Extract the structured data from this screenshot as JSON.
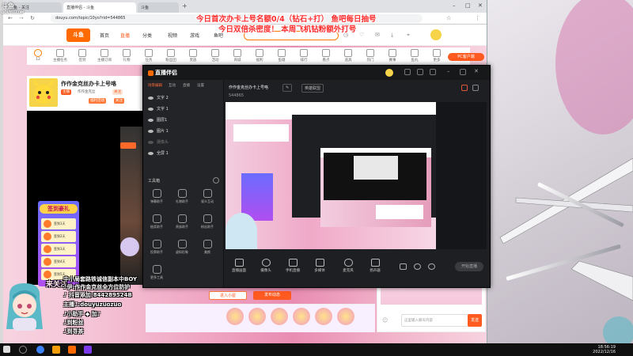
{
  "watermark": {
    "brand": "斗鱼",
    "sub": "DOUYU.COM"
  },
  "browser": {
    "tabs": [
      {
        "label": "斗鱼 - 关注"
      },
      {
        "label": "直播伴侣 - 斗鱼"
      },
      {
        "label": "斗鱼"
      }
    ],
    "url": "douyu.com/topic/10yo?rid=544865"
  },
  "site": {
    "logo": "斗鱼",
    "nav": [
      "首页",
      "直播",
      "分类",
      "视频",
      "游戏",
      "鱼吧"
    ],
    "icon_row": [
      "主播任务",
      "签到",
      "主播订阅",
      "礼物",
      "任务",
      "粉丝团",
      "贵族",
      "活动",
      "商城",
      "福利",
      "鱼塘",
      "排行",
      "看点",
      "道具",
      "热门",
      "赛事",
      "鱼丸",
      "更多"
    ],
    "level_label": "12",
    "pc_button": "PC客户端"
  },
  "stream": {
    "title": "作作金克丝办卡上号咯",
    "badges": [
      "主播",
      "作作金克丝",
      "关注"
    ],
    "fans_label": "福利活动",
    "follow_label": "关注"
  },
  "signin": {
    "header": "签到豪礼",
    "items": [
      "签到1天",
      "签到2天",
      "签到3天",
      "签到4天",
      "签到5天"
    ]
  },
  "chat": {
    "bubble": "可以在本机设置权限",
    "input_placeholder": "这里输入聊天内容",
    "send": "发送",
    "buttons": [
      "进入小屋",
      "发布动态"
    ]
  },
  "companion": {
    "title": "直播伴侣",
    "room_title": "作作金克丝办卡上号咯",
    "room_category": "英雄联盟",
    "room_id": "544865",
    "scene_tabs": [
      "场景编辑",
      "互动",
      "直播",
      "设置"
    ],
    "layers": [
      {
        "label": "文字 2",
        "dim": false
      },
      {
        "label": "文字 1",
        "dim": false
      },
      {
        "label": "图层1",
        "dim": false
      },
      {
        "label": "图片 1",
        "dim": false
      },
      {
        "label": "摄像头",
        "dim": true
      },
      {
        "label": "全屏 1",
        "dim": false
      }
    ],
    "toolbox_title": "工具箱",
    "tools": [
      "弹幕助手",
      "礼物助手",
      "观众互动",
      "抽奖助手",
      "贵族助手",
      "粉丝助手",
      "投票助手",
      "虚拟形象",
      "美颜",
      "更多工具"
    ],
    "controls": [
      "直播画面",
      "摄像头",
      "手机直播",
      "多媒体",
      "麦克风",
      "扬声器"
    ],
    "go_live": "开始直播"
  },
  "overlay": {
    "line1": "今日首次办卡上号名额0/4（钻石+打）  鱼吧每日抽号",
    "line2": "今日双倍杀密度！  本周飞机钻粉额外打号"
  },
  "danmu": [
    "来关注",
    "中小局套路铁诚信副本中BOY",
    "♪伊:作作金克丝全方位防护",
    "♪ 抖音添加:844289524B",
    "主播♪:douyuzuozuo",
    "♪小助手 ◆ 加♪",
    "♪到粉丝",
    "♪到寻茶"
  ],
  "taskbar": {
    "time": "18:56:19",
    "date": "2022/12/16"
  },
  "colors": {
    "accent": "#ff5a1f",
    "overlay_red": "#ff2d2d",
    "brand": "#ff6a00"
  }
}
